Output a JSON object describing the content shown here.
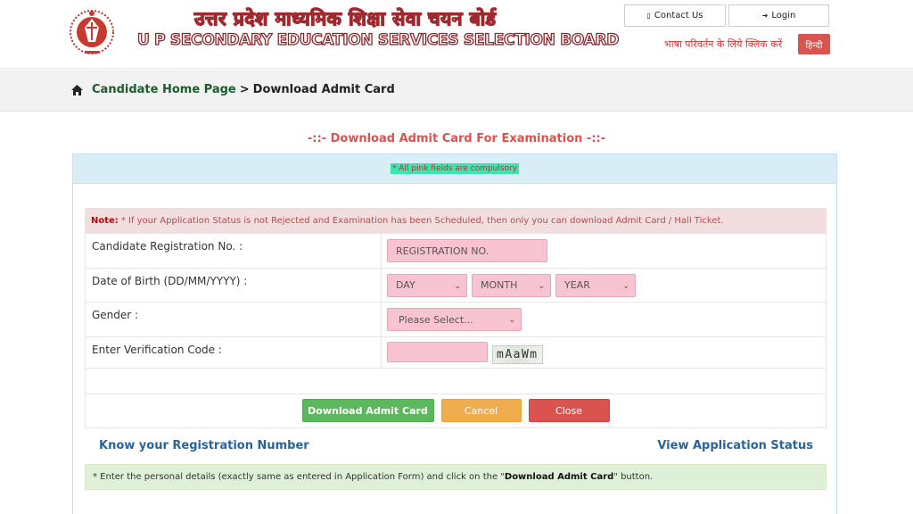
{
  "header": {
    "title_hindi": "उत्तर प्रदेश माध्यमिक शिक्षा सेवा चयन बोर्ड",
    "title_english": "U P SECONDARY EDUCATION SERVICES SELECTION BOARD",
    "contact_label": "Contact Us",
    "login_label": "Login",
    "language_prompt": "भाषा परिवर्तन के लिये क्लिक करें",
    "language_button": "हिन्दी"
  },
  "breadcrumb": {
    "home": "Candidate Home Page",
    "separator": ">",
    "current": "Download Admit Card"
  },
  "page": {
    "section_title": "-::- Download Admit Card For Examination -::-",
    "compulsory_note": "* All pink fields are compulsory",
    "note_label": "Note:",
    "note_text": "* If your Application Status is not Rejected and Examination has been Scheduled, then only you can download Admit Card / Hall Ticket."
  },
  "form": {
    "registration_label": "Candidate Registration No. :",
    "registration_placeholder": "REGISTRATION NO.",
    "dob_label": "Date of Birth (DD/MM/YYYY) :",
    "day_selected": "DAY",
    "month_selected": "MONTH",
    "year_selected": "YEAR",
    "gender_label": "Gender :",
    "gender_selected": "Please Select...",
    "verification_label": "Enter Verification Code :",
    "verification_value": "",
    "captcha_text": "mAaWm"
  },
  "buttons": {
    "download": "Download Admit Card",
    "cancel": "Cancel",
    "close": "Close"
  },
  "links": {
    "know_registration": "Know your Registration Number",
    "view_status": "View Application Status"
  },
  "info": {
    "prefix": "* Enter the personal details (exactly same as entered in Application Form) and click on the \"",
    "emphasis": "Download Admit Card",
    "suffix": " \" button."
  },
  "colors": {
    "pink_field": "#f9c4d2",
    "brand_red": "#9e2a2f",
    "green": "#5cb85c",
    "orange": "#f0ad4e",
    "red": "#d9534f",
    "link_blue": "#2a6496"
  },
  "icons": [
    "logo-emblem",
    "phone-icon",
    "login-icon",
    "home-icon",
    "chevron-down-icon"
  ]
}
